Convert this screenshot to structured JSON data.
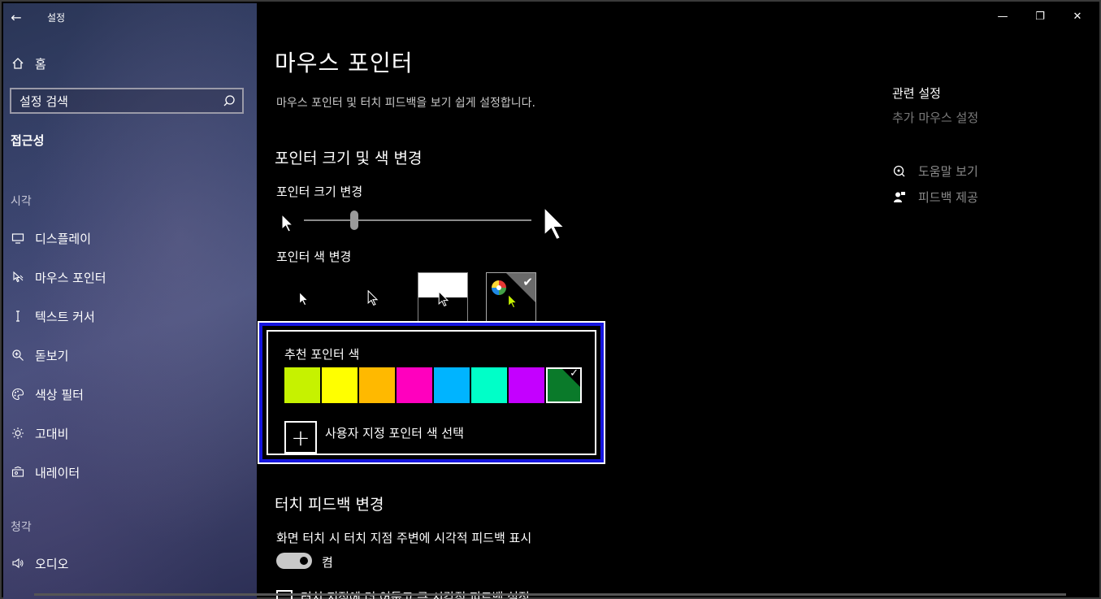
{
  "window": {
    "app_title": "설정",
    "caption": {
      "minimize": "—",
      "maximize": "❐",
      "close": "✕"
    }
  },
  "sidebar": {
    "home": "홈",
    "search_placeholder": "설정 검색",
    "current_section": "접근성",
    "groups": [
      {
        "label": "시각"
      },
      {
        "label": "청각"
      }
    ],
    "items": [
      {
        "label": "디스플레이",
        "icon": "monitor-icon"
      },
      {
        "label": "마우스 포인터",
        "icon": "mouse-pointer-icon"
      },
      {
        "label": "텍스트 커서",
        "icon": "text-cursor-icon"
      },
      {
        "label": "돋보기",
        "icon": "magnifier-icon"
      },
      {
        "label": "색상 필터",
        "icon": "palette-icon"
      },
      {
        "label": "고대비",
        "icon": "sun-icon"
      },
      {
        "label": "내레이터",
        "icon": "narrator-icon"
      },
      {
        "label": "오디오",
        "icon": "speaker-icon"
      }
    ]
  },
  "main": {
    "title": "마우스 포인터",
    "description": "마우스 포인터 및 터치 피드백을 보기 쉽게 설정합니다.",
    "pointer_section": {
      "heading": "포인터 크기 및 색 변경",
      "size_label": "포인터 크기 변경",
      "size_level": 0.22,
      "color_label": "포인터 색 변경",
      "color_options": [
        "white",
        "black",
        "inverted",
        "custom"
      ],
      "selected_option": "custom"
    },
    "recommended": {
      "title": "추천 포인터 색",
      "colors": [
        "#c6f200",
        "#ffff00",
        "#ffb900",
        "#ff00be",
        "#00b4ff",
        "#00ffc8",
        "#c400ff",
        "#0a7a2a"
      ],
      "selected_index": 7,
      "custom_label": "사용자 지정 포인터 색 선택"
    },
    "touch_section": {
      "heading": "터치 피드백 변경",
      "toggle_label": "화면 터치 시 터치 지점 주변에 시각적 피드백 표시",
      "toggle_state": "켬",
      "checkbox_label": "터치 지점에 더 어둡고 큰 시각적 피드백 설정"
    }
  },
  "related": {
    "heading": "관련 설정",
    "link": "추가 마우스 설정",
    "help": "도움말 보기",
    "feedback": "피드백 제공"
  },
  "accent": {
    "highlight_border": "#1616e0"
  }
}
